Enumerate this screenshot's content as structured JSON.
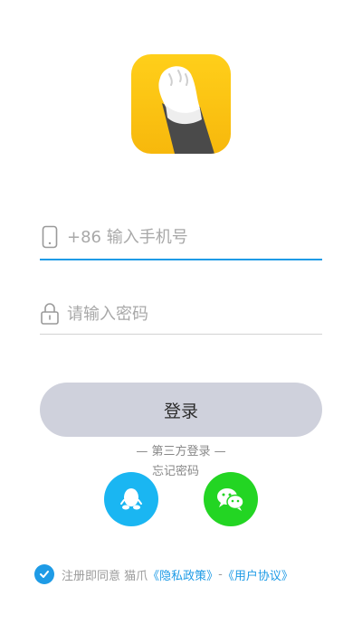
{
  "phone_field": {
    "placeholder": "+86 输入手机号"
  },
  "password_field": {
    "placeholder": "请输入密码"
  },
  "login_button": {
    "label": "登录"
  },
  "third_party_label": "— 第三方登录 —",
  "forgot_password": "忘记密码",
  "agreement": {
    "checked": true,
    "prefix": "注册即同意 猫爪",
    "privacy": "《隐私政策》",
    "separator": "-",
    "terms": "《用户协议》"
  },
  "colors": {
    "accent": "#1e9be6",
    "qq": "#1ab6f2",
    "wechat": "#23d523",
    "logo": "#ffcf1a",
    "button": "#cfd1dc"
  },
  "icons": [
    "app-logo-icon",
    "phone-icon",
    "lock-icon",
    "qq-icon",
    "wechat-icon",
    "checkmark-icon"
  ]
}
